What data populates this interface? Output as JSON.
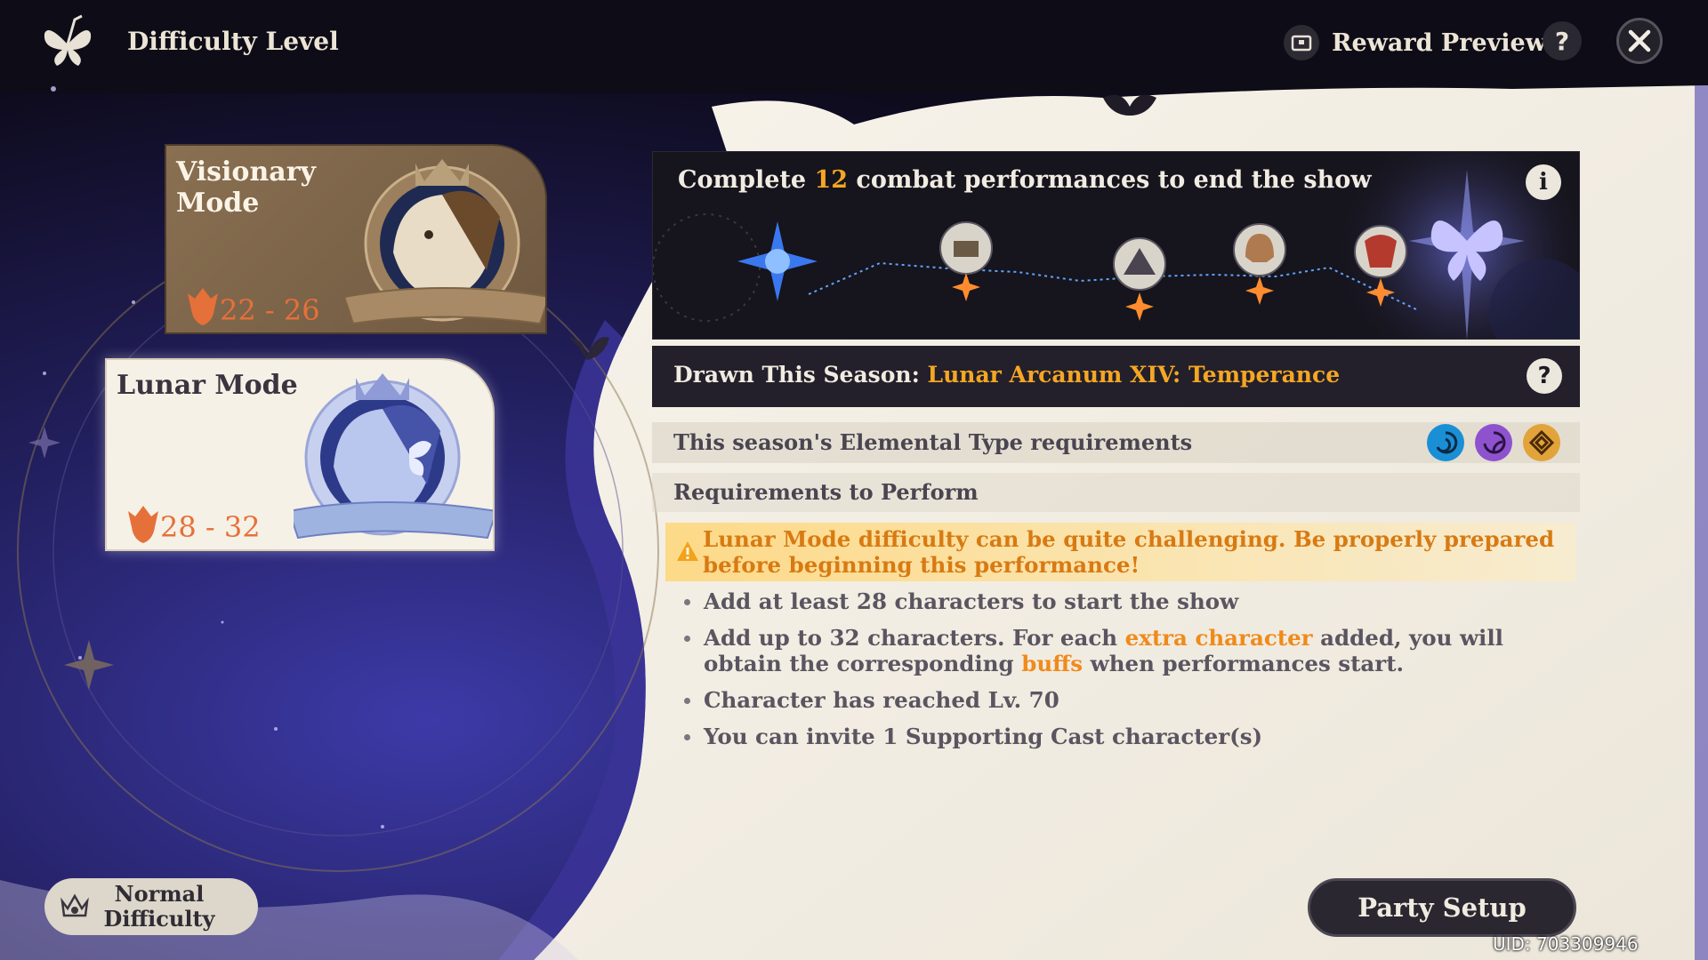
{
  "header": {
    "title": "Difficulty Level",
    "reward_preview_label": "Reward Preview",
    "help_icon": "question-icon",
    "close_icon": "close-icon"
  },
  "modes": [
    {
      "title": "Visionary Mode",
      "range": "22 - 26",
      "selected": false
    },
    {
      "title": "Lunar Mode",
      "range": "28 - 32",
      "selected": true
    }
  ],
  "normal_difficulty": {
    "label": "Normal\nDifficulty"
  },
  "show_banner": {
    "prefix": "Complete",
    "count": "12",
    "suffix": "combat performances to end the show",
    "stage_icons": [
      "blue-star-icon",
      "chest-stage-icon",
      "triangle-stage-icon",
      "helmet-stage-icon",
      "mask-stage-icon",
      "butterfly-finale-icon"
    ]
  },
  "season": {
    "label": "Drawn This Season:",
    "value": "Lunar Arcanum XIV: Temperance"
  },
  "elemental": {
    "label": "This season's Elemental Type requirements",
    "elements": [
      {
        "name": "hydro",
        "icon": "hydro-icon",
        "color": "#1a8fd6"
      },
      {
        "name": "electro",
        "icon": "electro-icon",
        "color": "#8e52cf"
      },
      {
        "name": "geo",
        "icon": "geo-icon",
        "color": "#e2a33a"
      }
    ]
  },
  "requirements": {
    "label": "Requirements to Perform",
    "warning": "Lunar Mode difficulty can be quite challenging. Be properly prepared before beginning this performance!",
    "bullet1": "Add at least 28 characters to start the show",
    "bullet2_a": "Add up to 32 characters. For each",
    "bullet2_hl1": "extra character",
    "bullet2_b": "added, you will obtain the corresponding",
    "bullet2_hl2": "buffs",
    "bullet2_c": "when performances start.",
    "bullet3": "Character has reached Lv. 70",
    "bullet4": "You can invite 1 Supporting Cast character(s)"
  },
  "party_setup_label": "Party Setup",
  "uid": "UID: 703309946",
  "colors": {
    "accent_orange": "#f5a623",
    "highlight_orange": "#f08a1a",
    "dark_panel": "#16141c",
    "cream": "#f3eee4"
  }
}
